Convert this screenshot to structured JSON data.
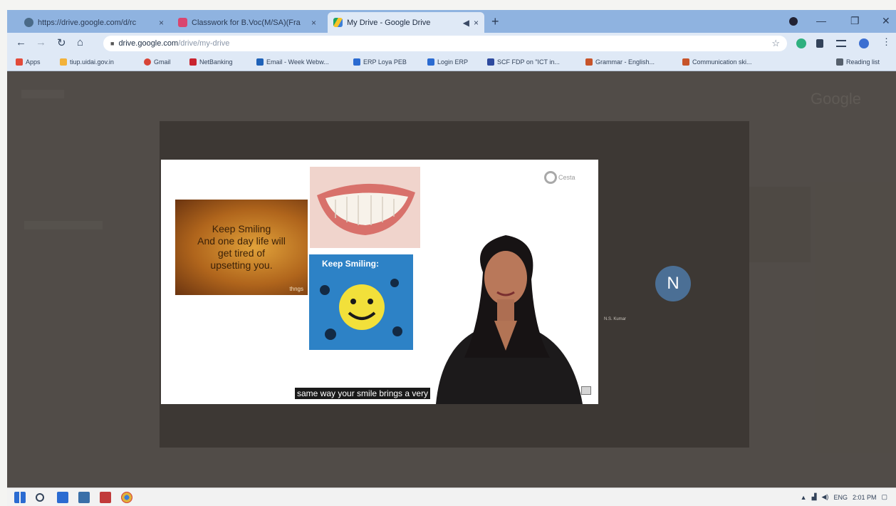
{
  "browser": {
    "tabs": [
      {
        "label": "https://drive.google.com/d/rc",
        "favicon_color": "#4a6a88",
        "close": "×",
        "active": false
      },
      {
        "label": "Classwork for B.Voc(M/SA)(Fra",
        "favicon_color": "#d9466f",
        "close": "×",
        "active": false
      },
      {
        "label": "My Drive - Google Drive",
        "favicon_color": "#3c7fd8",
        "close": "×",
        "active": true
      }
    ],
    "new_tab": "+",
    "window_controls": [
      "—",
      "❐",
      "✕"
    ],
    "nav": {
      "back": "←",
      "forward": "→",
      "reload": "↻",
      "home": "⌂"
    },
    "address": {
      "host": "drive.google.com",
      "path": "/drive/my-drive",
      "lock": "🔒"
    },
    "bookmarks": [
      {
        "label": "Apps",
        "color": "#e24b3a"
      },
      {
        "label": "tiup.uidai.gov.in",
        "color": "#f2b23a"
      },
      {
        "label": "Gmail",
        "color": "#d84437"
      },
      {
        "label": "NetBanking",
        "color": "#c9242f"
      },
      {
        "label": "Email - Week Webw...",
        "color": "#1f62b8"
      },
      {
        "label": "ERP Loya PEB",
        "color": "#2b6bd1"
      },
      {
        "label": "Login ERP",
        "color": "#2b6bd1"
      },
      {
        "label": "SCF FDP on \"ICT in...",
        "color": "#2e4a9e"
      },
      {
        "label": "Grammar - English...",
        "color": "#c7542a"
      },
      {
        "label": "Communication ski...",
        "color": "#c7542a"
      },
      {
        "label": "Reading list",
        "color": "#56606c"
      }
    ]
  },
  "page": {
    "google_label": "Google"
  },
  "video": {
    "quote_text": "Keep Smiling\nAnd one day life will\nget tired of\nupsetting you.",
    "quote_mark": "thngs",
    "smiley_caption": "Keep Smiling:",
    "brand": "Cesta",
    "subtitle": "same way your smile brings a very",
    "participant_initial": "N",
    "participant_name": "N.S. Kumar"
  },
  "taskbar": {
    "apps": [
      "windows-start",
      "search",
      "mail",
      "file-explorer",
      "media",
      "chrome"
    ],
    "tray": {
      "lang": "ENG",
      "time": "2:01 PM"
    }
  }
}
